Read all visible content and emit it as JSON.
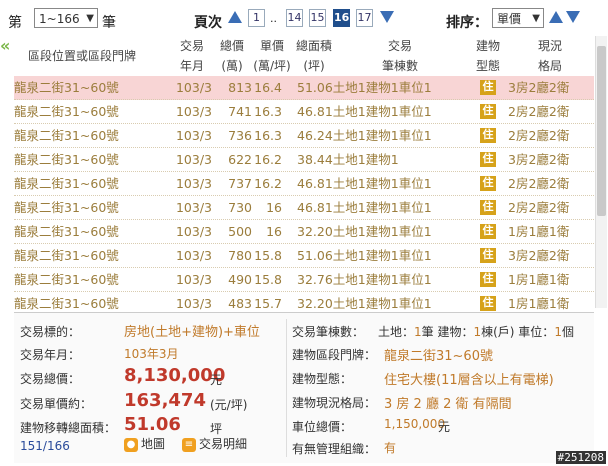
{
  "toolbar": {
    "prefix": "第",
    "range_value": "1~166",
    "suffix": "筆",
    "page_label": "頁次",
    "pages": [
      "1",
      "..",
      "14",
      "15",
      "16",
      "17"
    ],
    "current_page": "16",
    "sort_label": "排序：",
    "sort_value": "單價"
  },
  "table": {
    "headers": {
      "location": "區段位置或區段門牌",
      "date_1": "交易",
      "date_2": "年月",
      "price_1": "總價",
      "price_2": "(萬)",
      "unit_1": "單價",
      "unit_2": "(萬/坪)",
      "area_1": "總面積",
      "area_2": "(坪)",
      "tx_1": "交易",
      "tx_2": "筆棟數",
      "type_1": "建物",
      "type_2": "型態",
      "layout_1": "現況",
      "layout_2": "格局"
    },
    "rows": [
      {
        "loc": "龍泉二街31~60號",
        "date": "103/3",
        "price": "813",
        "unit": "16.4",
        "area": "51.06",
        "tx": "土地1建物1車位1",
        "type": "住",
        "layout": "3房2廳2衛"
      },
      {
        "loc": "龍泉二街31~60號",
        "date": "103/3",
        "price": "741",
        "unit": "16.3",
        "area": "46.81",
        "tx": "土地1建物1車位1",
        "type": "住",
        "layout": "2房2廳2衛"
      },
      {
        "loc": "龍泉二街31~60號",
        "date": "103/3",
        "price": "736",
        "unit": "16.3",
        "area": "46.24",
        "tx": "土地1建物1車位1",
        "type": "住",
        "layout": "2房2廳2衛"
      },
      {
        "loc": "龍泉二街31~60號",
        "date": "103/3",
        "price": "622",
        "unit": "16.2",
        "area": "38.44",
        "tx": "土地1建物1",
        "type": "住",
        "layout": "3房2廳2衛"
      },
      {
        "loc": "龍泉二街31~60號",
        "date": "103/3",
        "price": "737",
        "unit": "16.2",
        "area": "46.81",
        "tx": "土地1建物1車位1",
        "type": "住",
        "layout": "2房2廳2衛"
      },
      {
        "loc": "龍泉二街31~60號",
        "date": "103/3",
        "price": "730",
        "unit": "16",
        "area": "46.81",
        "tx": "土地1建物1車位1",
        "type": "住",
        "layout": "2房2廳2衛"
      },
      {
        "loc": "龍泉二街31~60號",
        "date": "103/3",
        "price": "500",
        "unit": "16",
        "area": "32.20",
        "tx": "土地1建物1車位1",
        "type": "住",
        "layout": "1房1廳1衛"
      },
      {
        "loc": "龍泉二街31~60號",
        "date": "103/3",
        "price": "780",
        "unit": "15.8",
        "area": "51.06",
        "tx": "土地1建物1車位1",
        "type": "住",
        "layout": "3房2廳2衛"
      },
      {
        "loc": "龍泉二街31~60號",
        "date": "103/3",
        "price": "490",
        "unit": "15.8",
        "area": "32.76",
        "tx": "土地1建物1車位1",
        "type": "住",
        "layout": "1房1廳1衛"
      },
      {
        "loc": "龍泉二街31~60號",
        "date": "103/3",
        "price": "483",
        "unit": "15.7",
        "area": "32.20",
        "tx": "土地1建物1車位1",
        "type": "住",
        "layout": "1房1廳1衛"
      }
    ]
  },
  "detail": {
    "target_label": "交易標的：",
    "target_value": "房地(土地+建物)+車位",
    "date_label": "交易年月：",
    "date_value": "103年3月",
    "total_label": "交易總價：",
    "total_value": "8,130,000",
    "total_unit": "元",
    "unit_label": "交易單價約：",
    "unit_value": "163,474",
    "unit_unit": "(元/坪)",
    "area_label": "建物移轉總面積：",
    "area_value": "51.06",
    "area_unit": "坪",
    "count": "151/166",
    "map_button": "地圖",
    "detail_button": "交易明細",
    "tx_label": "交易筆棟數：",
    "tx_land": "土地：",
    "tx_land_v": "1",
    "tx_land_u": "筆 建物：",
    "tx_bld_v": "1",
    "tx_bld_u": "棟(戶) 車位：",
    "tx_park_v": "1",
    "tx_park_u": "個",
    "addr_label": "建物區段門牌：",
    "addr_value": "龍泉二街31~60號",
    "type_label": "建物型態：",
    "type_value": "住宅大樓(11層含以上有電梯)",
    "layout_label": "建物現況格局：",
    "layout_value": "3 房 2 廳 2 衛 有隔間",
    "parking_label": "車位總價：",
    "parking_value": "1,150,000",
    "parking_unit": "元",
    "mgmt_label": "有無管理組織：",
    "mgmt_value": "有"
  },
  "watermark": "#251208"
}
